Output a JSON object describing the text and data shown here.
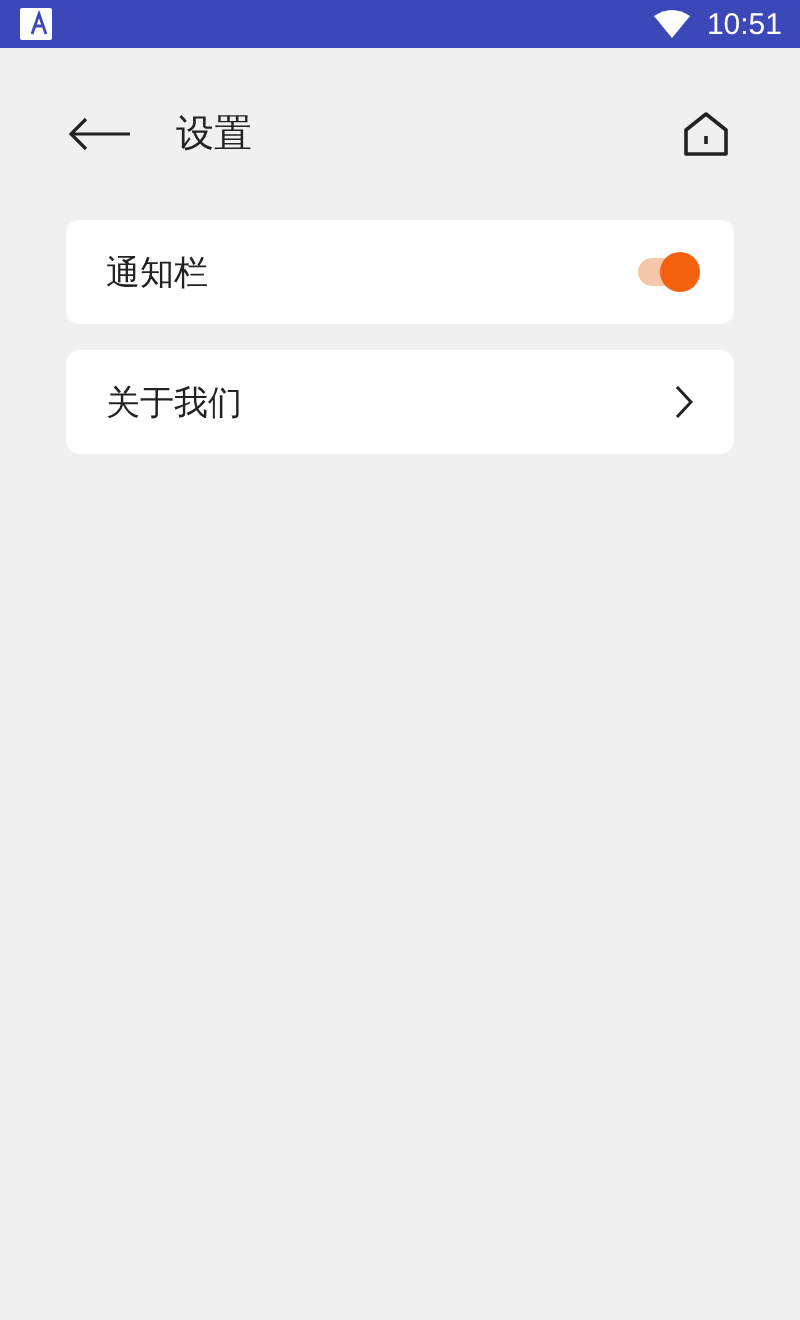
{
  "status_bar": {
    "time": "10:51"
  },
  "header": {
    "title": "设置"
  },
  "items": [
    {
      "kind": "toggle",
      "label": "通知栏",
      "on": true
    },
    {
      "kind": "link",
      "label": "关于我们"
    }
  ]
}
